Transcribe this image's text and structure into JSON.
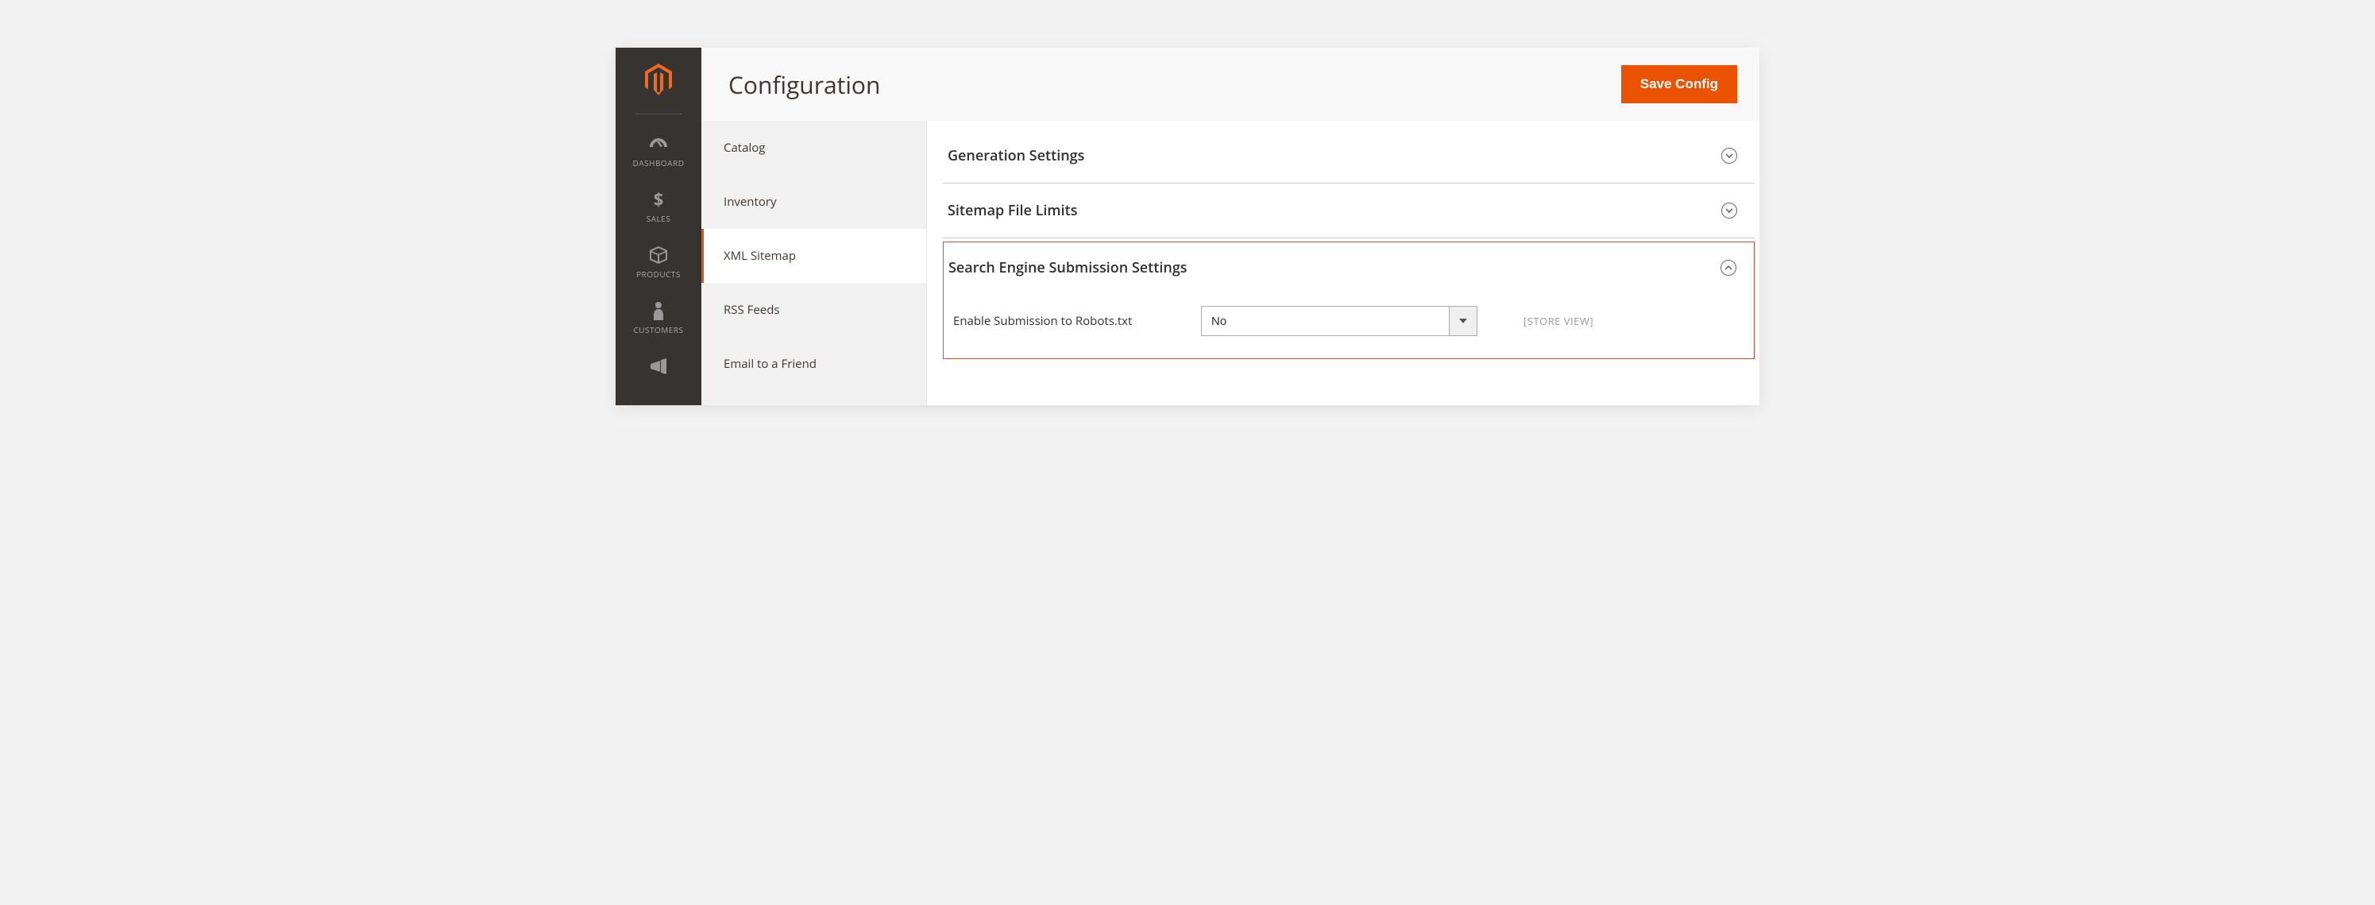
{
  "header": {
    "title": "Configuration",
    "save_label": "Save Config"
  },
  "adminNav": {
    "items": [
      {
        "id": "dashboard",
        "label": "DASHBOARD"
      },
      {
        "id": "sales",
        "label": "SALES"
      },
      {
        "id": "products",
        "label": "PRODUCTS"
      },
      {
        "id": "customers",
        "label": "CUSTOMERS"
      },
      {
        "id": "marketing",
        "label": ""
      }
    ]
  },
  "configTabs": {
    "items": [
      {
        "id": "catalog",
        "label": "Catalog",
        "active": false
      },
      {
        "id": "inventory",
        "label": "Inventory",
        "active": false
      },
      {
        "id": "xmlsitemap",
        "label": "XML Sitemap",
        "active": true
      },
      {
        "id": "rss",
        "label": "RSS Feeds",
        "active": false
      },
      {
        "id": "email",
        "label": "Email to a Friend",
        "active": false
      }
    ]
  },
  "sections": {
    "generation": {
      "title": "Generation Settings",
      "expanded": false
    },
    "filelimits": {
      "title": "Sitemap File Limits",
      "expanded": false
    },
    "submission": {
      "title": "Search Engine Submission Settings",
      "expanded": true,
      "fields": {
        "robots": {
          "label": "Enable Submission to Robots.txt",
          "value": "No",
          "scope": "[STORE VIEW]"
        }
      }
    }
  }
}
